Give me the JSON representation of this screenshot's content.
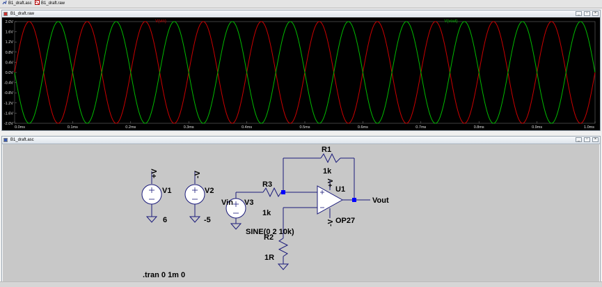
{
  "tabs": [
    {
      "label": "B1_draft.asc",
      "icon": "schematic-icon"
    },
    {
      "label": "B1_draft.raw",
      "icon": "waveform-icon"
    }
  ],
  "waveform_window": {
    "title": "B1_draft.raw"
  },
  "schematic_window": {
    "title": "B1_draft.asc"
  },
  "window_controls": {
    "minimize": "_",
    "restore": "▫",
    "close": "×"
  },
  "colors": {
    "plot_bg": "#000000",
    "vin_trace": "#cc0000",
    "vout_trace": "#00bb00",
    "wire": "#1a1a7a",
    "node": "#0000ff",
    "schematic_bg": "#c8c8c8"
  },
  "chart_data": {
    "type": "line",
    "title": "",
    "xlabel": "",
    "ylabel": "",
    "xlim": [
      0,
      1.0
    ],
    "ylim": [
      -2.0,
      2.0
    ],
    "x_ticks": [
      "0.0ms",
      "0.1ms",
      "0.2ms",
      "0.3ms",
      "0.4ms",
      "0.5ms",
      "0.6ms",
      "0.7ms",
      "0.8ms",
      "0.9ms",
      "1.0ms"
    ],
    "y_ticks": [
      "2.0V",
      "1.6V",
      "1.2V",
      "0.8V",
      "0.4V",
      "0.0V",
      "-0.4V",
      "-0.8V",
      "-1.2V",
      "-1.6V",
      "-2.0V"
    ],
    "grid": false,
    "series": [
      {
        "name": "V(vin)",
        "function": "sine",
        "amplitude_V": 2,
        "frequency_Hz": 10000,
        "offset_V": 0,
        "color": "#cc0000"
      },
      {
        "name": "V(vout)",
        "function": "sine",
        "amplitude_V": -2,
        "frequency_Hz": 10000,
        "offset_V": 0,
        "color": "#00bb00"
      }
    ]
  },
  "schematic": {
    "v1": {
      "name": "V1",
      "value": "6",
      "net": "+V"
    },
    "v2": {
      "name": "V2",
      "value": "-5",
      "net": "-V"
    },
    "v3": {
      "name": "V3",
      "value": "SINE(0 2 10k)",
      "net": "Vin"
    },
    "r1": {
      "name": "R1",
      "value": "1k"
    },
    "r2": {
      "name": "R2",
      "value": "1R"
    },
    "r3": {
      "name": "R3",
      "value": "1k"
    },
    "u1": {
      "name": "U1",
      "model": "OP27",
      "pos_supply": "+V",
      "neg_supply": "-V"
    },
    "vout_label": "Vout",
    "directive": ".tran 0 1m 0"
  }
}
